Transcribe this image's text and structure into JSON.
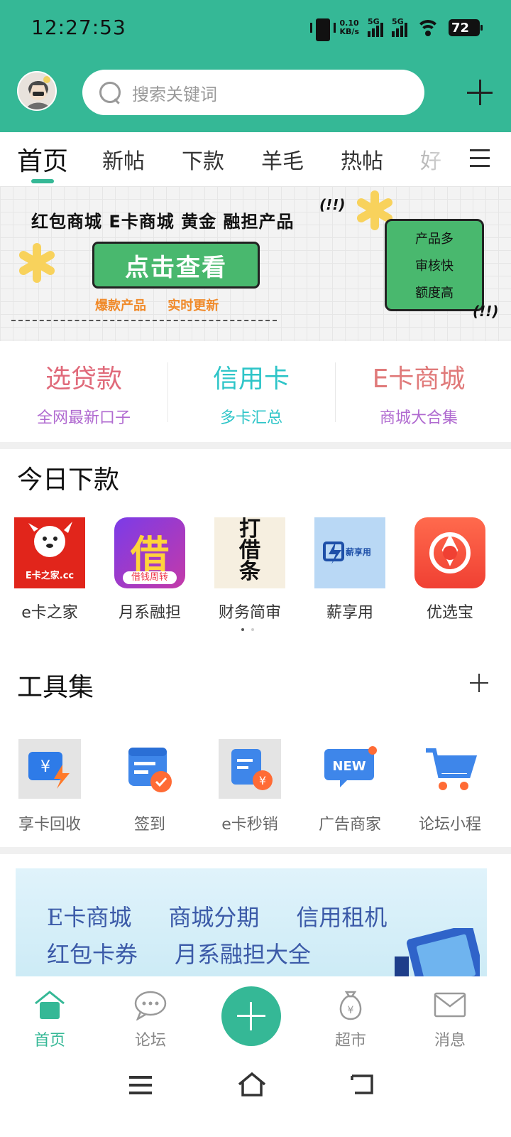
{
  "status_bar": {
    "time": "12:27:53",
    "net_speed_value": "0.10",
    "net_speed_unit": "KB/s",
    "sim1": "5G",
    "sim2": "5G",
    "battery": "72"
  },
  "header": {
    "search_placeholder": "搜索关键词"
  },
  "tabs": [
    "首页",
    "新帖",
    "下款",
    "羊毛",
    "热帖",
    "好"
  ],
  "banner": {
    "title": "红包商城  E卡商城  黄金  融担产品",
    "button": "点击查看",
    "subtitle": "爆款产品 实时更新",
    "card_lines": [
      "产品多",
      "审核快",
      "额度高"
    ],
    "exclaim": "(!!)"
  },
  "quick_links": [
    {
      "title": "选贷款",
      "subtitle": "全网最新口子",
      "title_color": "#e06a7a",
      "sub_color": "#b06ad0"
    },
    {
      "title": "信用卡",
      "subtitle": "多卡汇总",
      "title_color": "#2ec5c8",
      "sub_color": "#2ec5c8"
    },
    {
      "title": "E卡商城",
      "subtitle": "商城大合集",
      "title_color": "#e07a7a",
      "sub_color": "#b06ad0"
    }
  ],
  "today": {
    "title": "今日下款",
    "apps": [
      {
        "label": "e卡之家",
        "icon_text": "E卡之家.cc"
      },
      {
        "label": "月系融担",
        "icon_text": "借",
        "icon_sub": "借钱周转"
      },
      {
        "label": "财务简审",
        "icon_text": "打借条"
      },
      {
        "label": "薪享用",
        "icon_text": "薪享用"
      },
      {
        "label": "优选宝",
        "icon_text": ""
      }
    ]
  },
  "tools": {
    "title": "工具集",
    "items": [
      {
        "label": "享卡回收",
        "icon": "card-recycle-icon"
      },
      {
        "label": "签到",
        "icon": "calendar-check-icon"
      },
      {
        "label": "e卡秒销",
        "icon": "ecard-sell-icon"
      },
      {
        "label": "广告商家",
        "icon": "new-badge-icon"
      },
      {
        "label": "论坛小程",
        "icon": "cart-icon"
      }
    ]
  },
  "promo": {
    "row1": [
      "E卡商城",
      "商城分期",
      "信用租机"
    ],
    "row2": [
      "红包卡券",
      "月系融担大全"
    ]
  },
  "bottom_nav": [
    {
      "label": "首页",
      "icon": "home-icon"
    },
    {
      "label": "论坛",
      "icon": "chat-icon"
    },
    {
      "label": "超市",
      "icon": "money-bag-icon"
    },
    {
      "label": "消息",
      "icon": "mail-icon"
    }
  ],
  "colors": {
    "brand": "#35b896"
  }
}
